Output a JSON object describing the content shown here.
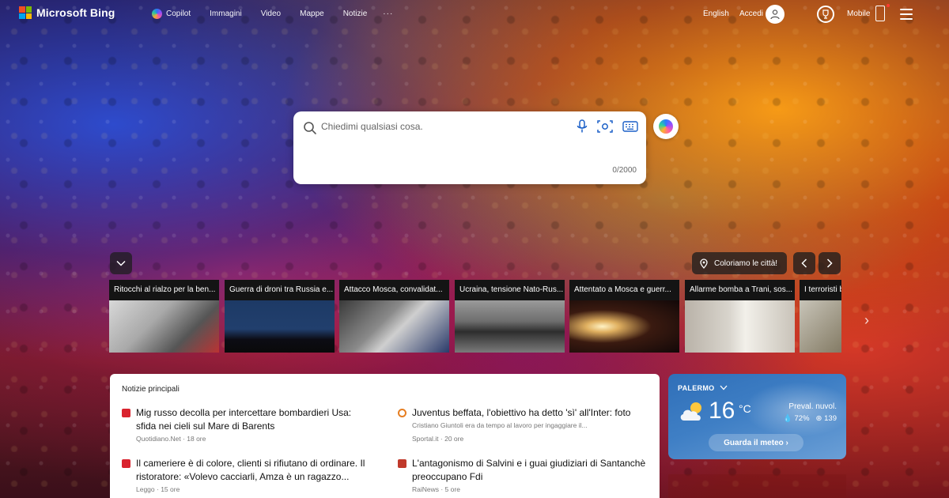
{
  "brand": {
    "logo_text": "Microsoft Bing",
    "colors": [
      "#f25022",
      "#7fba00",
      "#00a4ef",
      "#ffb900"
    ]
  },
  "nav": [
    {
      "label": "Copilot",
      "icon": "copilot-icon"
    },
    {
      "label": "Immagini"
    },
    {
      "label": "Video"
    },
    {
      "label": "Mappe"
    },
    {
      "label": "Notizie"
    },
    {
      "label": "···"
    }
  ],
  "header": {
    "language": "English",
    "signin": "Accedi",
    "mobile": "Mobile"
  },
  "search": {
    "placeholder": "Chiedimi qualsiasi cosa.",
    "counter": "0/2000"
  },
  "carousel": {
    "colour_label": "Coloriamo le città!",
    "cards": [
      {
        "title": "Ritocchi al rialzo per la ben...",
        "img": "linear-gradient(135deg,#d8d8d8 0%,#a9a9a9 40%,#555 70%,#b33 100%)"
      },
      {
        "title": "Guerra di droni tra Russia e...",
        "img": "linear-gradient(180deg,#1d3a66 0%,#213f6d 55%,#0c0c14 75%,#0a0a0a 100%)"
      },
      {
        "title": "Attacco Mosca, convalidat...",
        "img": "linear-gradient(135deg,#3a3a3a 0%,#8a8a8a 40%,#cfcfcf 55%,#2a3a6a 100%)"
      },
      {
        "title": "Ucraina, tensione Nato-Rus...",
        "img": "linear-gradient(180deg,#9a9a9a 0%,#6e6e6e 40%,#2e2e2e 60%,#7a7a7a 100%)"
      },
      {
        "title": "Attentato a Mosca e guerr...",
        "img": "radial-gradient(ellipse at 30% 50%,#fff2c4 0%,#e0b060 15%,#3a1a10 45%,#120808 100%)"
      },
      {
        "title": "Allarme bomba a Trani, sos...",
        "img": "linear-gradient(90deg,#b9b2a8 0%,#d8d4cc 40%,#f2f0ea 55%,#c9c3b9 100%)"
      },
      {
        "title": "I terroristi bloccati",
        "img": "linear-gradient(135deg,#c8c4b8 0%,#8d8570 50%,#4a4438 100%)"
      }
    ]
  },
  "news": {
    "heading": "Notizie principali",
    "items": [
      {
        "title": "Mig russo decolla per intercettare bombardieri Usa: sfida nei cieli sul Mare di Barents",
        "meta": "Quotidiano.Net · 18 ore",
        "icon_color": "#d9232e"
      },
      {
        "title": "Juventus beffata, l'obiettivo ha detto 'sì' all'Inter: foto",
        "meta": "Cristiano Giuntoli era da tempo al lavoro per ingaggiare il...",
        "meta2": "Sportal.it · 20 ore",
        "icon_color": "#e67e22"
      },
      {
        "title": "Il cameriere è di colore, clienti si rifiutano di ordinare. Il ristoratore: «Volevo cacciarli, Amza è un ragazzo...",
        "meta": "Leggo · 15 ore",
        "icon_color": "#d9232e"
      },
      {
        "title": "L'antagonismo di Salvini e i guai giudiziari di Santanchè preoccupano Fdi",
        "meta": "RaiNews · 5 ore",
        "icon_color": "#c0392b"
      }
    ]
  },
  "weather": {
    "city": "PALERMO",
    "temp": "16",
    "unit": "°C",
    "desc": "Preval. nuvol.",
    "humidity": "72%",
    "aqi": "139",
    "button": "Guarda il meteo"
  }
}
